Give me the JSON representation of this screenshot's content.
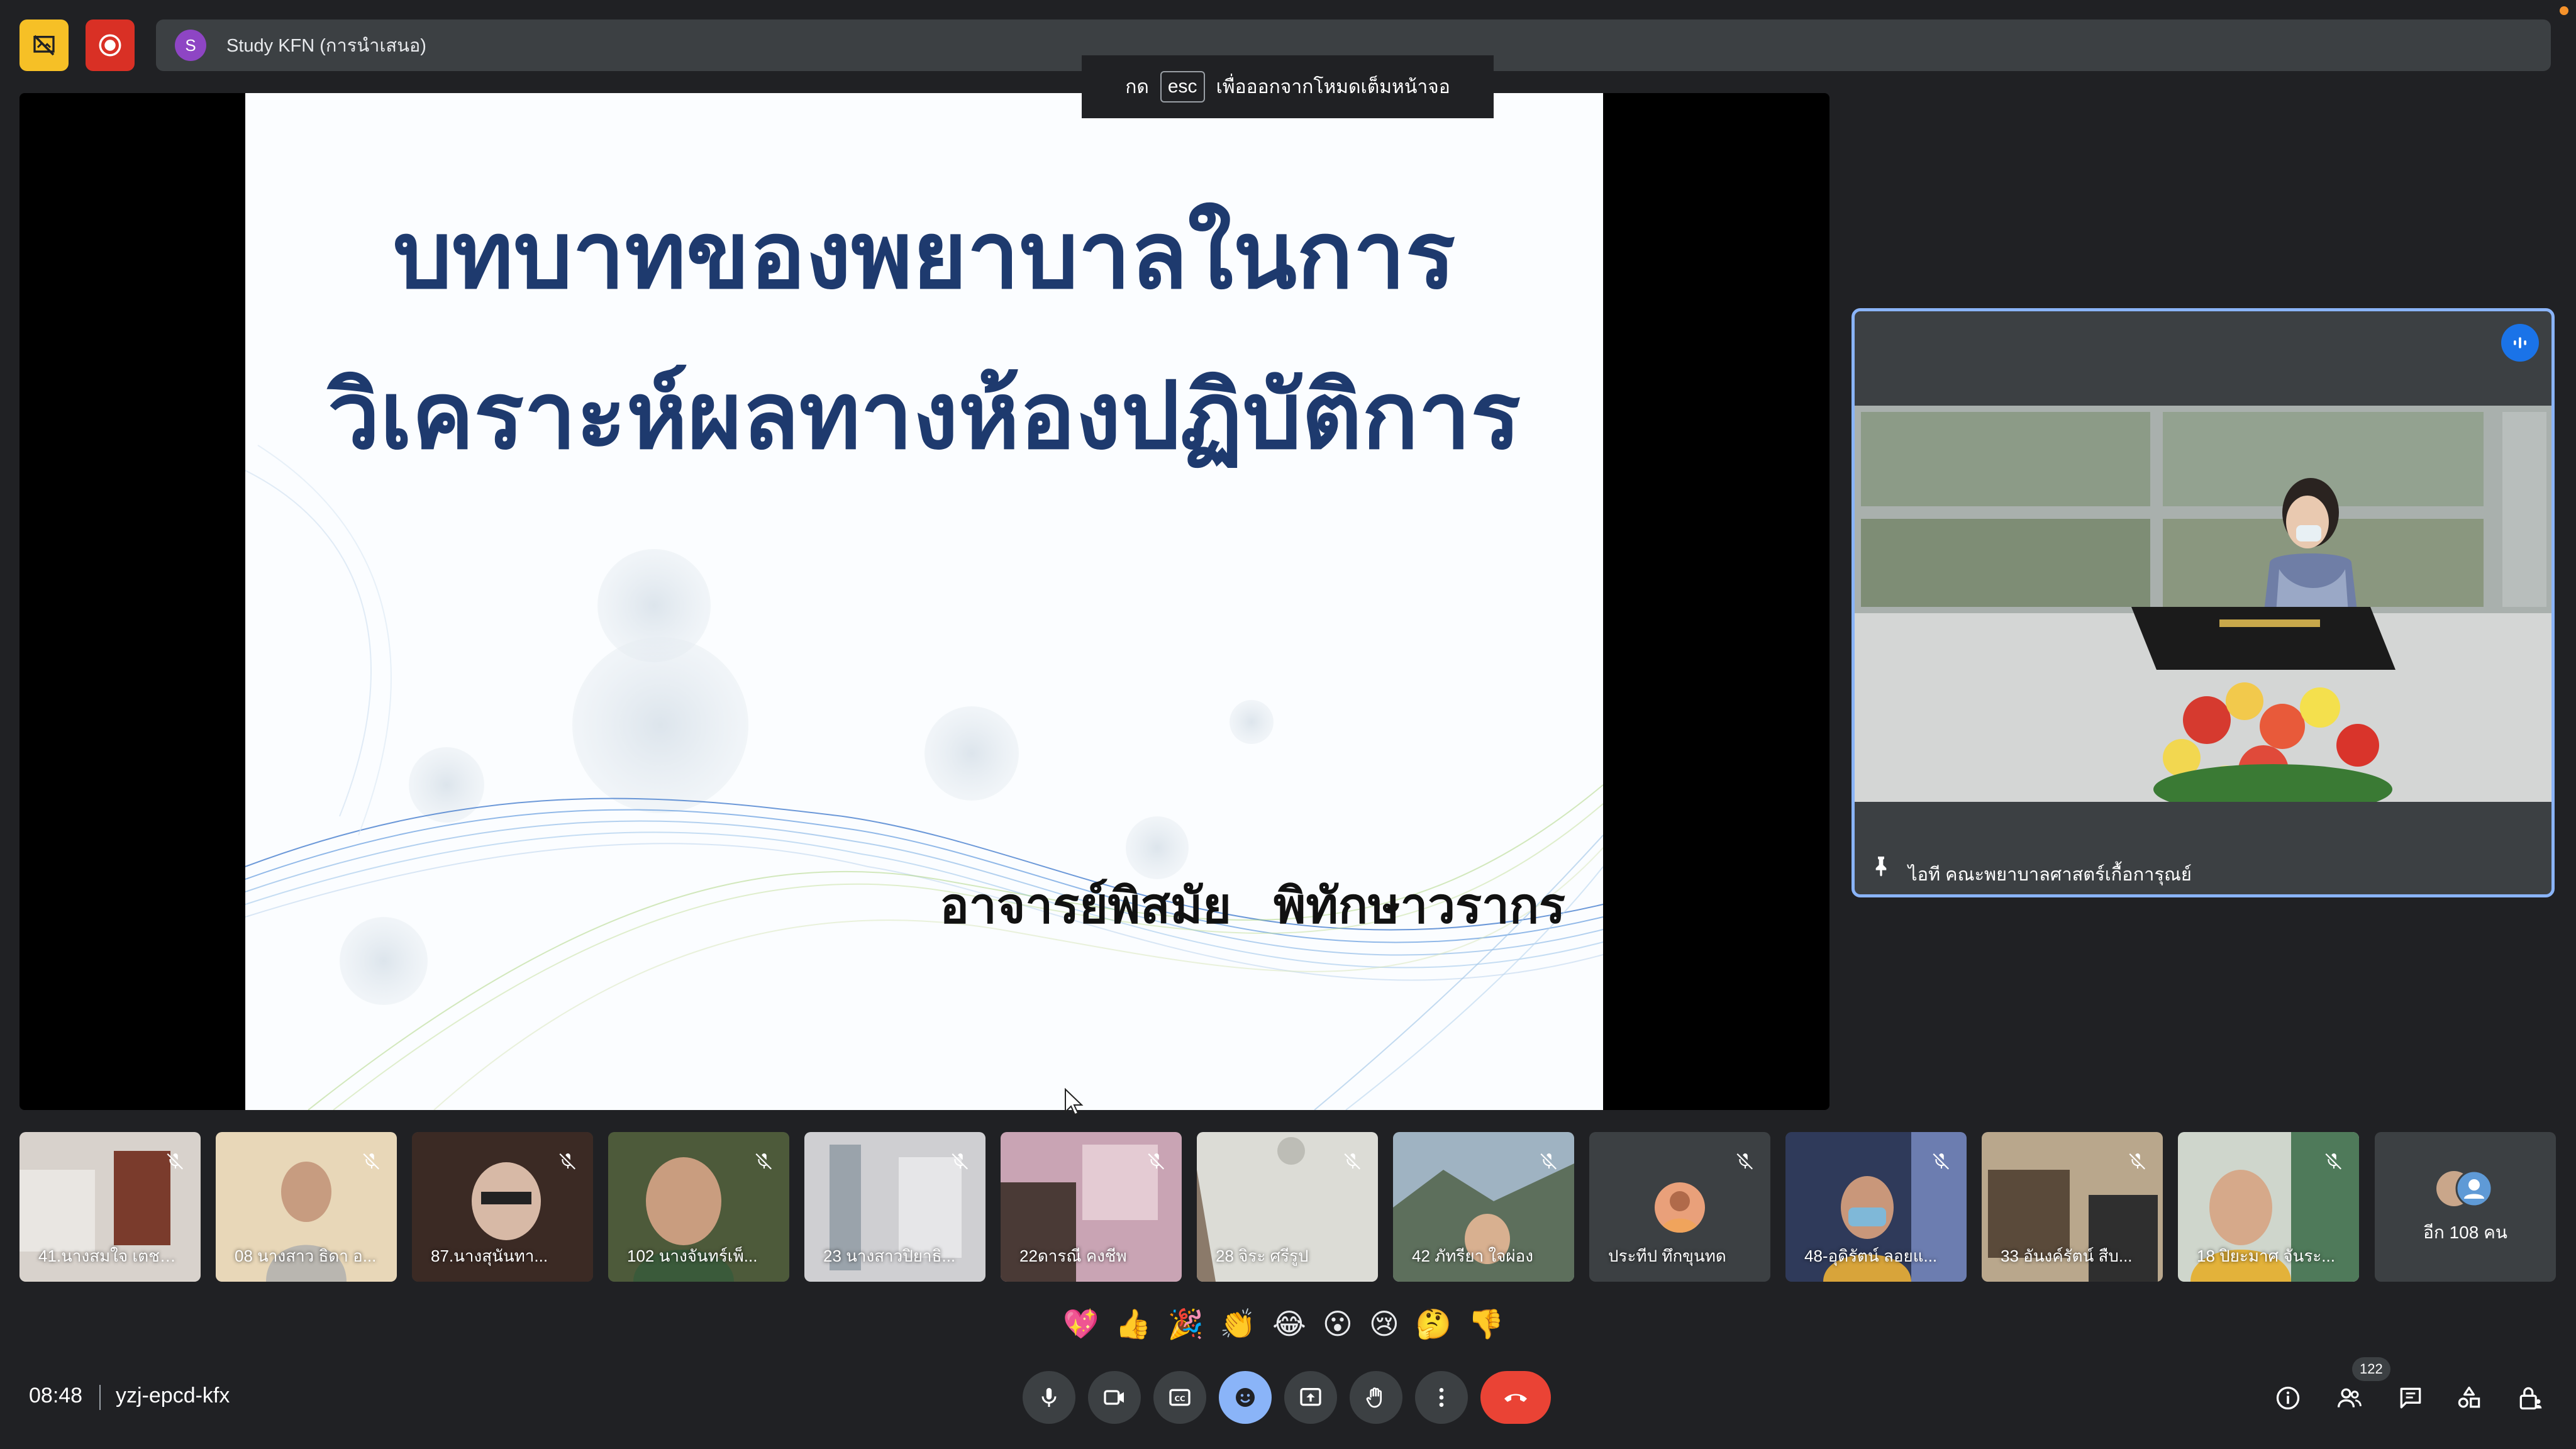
{
  "meeting": {
    "title": "Study KFN (การนำเสนอ)",
    "title_initial": "S",
    "time": "08:48",
    "code": "yzj-epcd-kfx"
  },
  "toast": {
    "prefix": "กด",
    "key": "esc",
    "suffix": "เพื่อออกจากโหมดเต็มหน้าจอ"
  },
  "slide": {
    "title_line1": "บทบาทของพยาบาลในการ",
    "title_line2": "วิเคราะห์ผลทางห้องปฏิบัติการ",
    "author": "อาจารย์พิสมัย พิทักษาวรากร"
  },
  "speaker": {
    "name": "ไอที คณะพยาบาลศาสตร์เกื้อการุณย์"
  },
  "participants": [
    {
      "name": "41.นางสมใจ เตชะ..."
    },
    {
      "name": "08 นางสาว ธิดา อ..."
    },
    {
      "name": "87.นางสุนันทา..."
    },
    {
      "name": "102 นางจันทร์เพ็..."
    },
    {
      "name": "23 นางสาวปิยาธิ..."
    },
    {
      "name": "22ดารณี คงชีพ"
    },
    {
      "name": "28 จิระ ศรีรูป"
    },
    {
      "name": "42 ภัทรียา ใจผ่อง"
    },
    {
      "name": "ประทีป ทึกขุนทด"
    },
    {
      "name": "48-อุดิรัตน์ ลอยแ..."
    },
    {
      "name": "33 อันงค์รัตน์ สืบ..."
    },
    {
      "name": "18 ปิยะมาศ จันระ..."
    }
  ],
  "more": {
    "label": "อีก 108 คน"
  },
  "reactions": [
    "💖",
    "👍",
    "🎉",
    "👏",
    "😂",
    "😮",
    "😢",
    "🤔",
    "👎"
  ],
  "people_count": "122",
  "colors": {
    "accent": "#8ab4f8",
    "leave": "#ea4335",
    "record": "#d93025",
    "annotate": "#f6c026"
  }
}
